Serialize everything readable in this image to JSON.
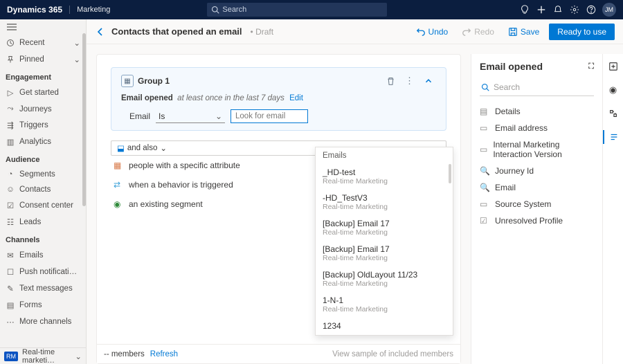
{
  "topbar": {
    "app": "Dynamics 365",
    "module": "Marketing",
    "search_placeholder": "Search",
    "avatar_initials": "JM"
  },
  "leftnav": {
    "recent": "Recent",
    "pinned": "Pinned",
    "sections": [
      {
        "title": "Engagement",
        "items": [
          "Get started",
          "Journeys",
          "Triggers",
          "Analytics"
        ]
      },
      {
        "title": "Audience",
        "items": [
          "Segments",
          "Contacts",
          "Consent center",
          "Leads"
        ]
      },
      {
        "title": "Channels",
        "items": [
          "Emails",
          "Push notifications",
          "Text messages",
          "Forms",
          "More channels"
        ]
      }
    ],
    "footer_badge": "RM",
    "footer_label": "Real-time marketi…"
  },
  "cmdbar": {
    "title": "Contacts that opened an email",
    "status": "Draft",
    "undo": "Undo",
    "redo": "Redo",
    "save": "Save",
    "primary": "Ready to use"
  },
  "group": {
    "title": "Group 1",
    "cond_label": "Email opened",
    "cond_detail": "at least once in the last 7 days",
    "edit": "Edit",
    "filter_label": "Email",
    "operator": "Is",
    "email_placeholder": "Look for email"
  },
  "andalso_label": "and also",
  "suggestions": [
    "people with a specific attribute",
    "when a behavior is triggered",
    "an existing segment"
  ],
  "dropdown": {
    "header": "Emails",
    "items": [
      {
        "name": "_HD-test",
        "sub": "Real-time Marketing"
      },
      {
        "name": "-HD_TestV3",
        "sub": "Real-time Marketing"
      },
      {
        "name": "[Backup] Email 17",
        "sub": "Real-time Marketing"
      },
      {
        "name": "[Backup] Email 17",
        "sub": "Real-time Marketing"
      },
      {
        "name": "[Backup] OldLayout 11/23",
        "sub": "Real-time Marketing"
      },
      {
        "name": "1-N-1",
        "sub": "Real-time Marketing"
      },
      {
        "name": "1234",
        "sub": ""
      }
    ]
  },
  "rpanel": {
    "title": "Email opened",
    "search_placeholder": "Search",
    "attributes": [
      "Details",
      "Email address",
      "Internal Marketing Interaction Version",
      "Journey Id",
      "Email",
      "Source System",
      "Unresolved Profile"
    ]
  },
  "footer": {
    "members": "-- members",
    "refresh": "Refresh",
    "viewsample": "View sample of included members"
  }
}
